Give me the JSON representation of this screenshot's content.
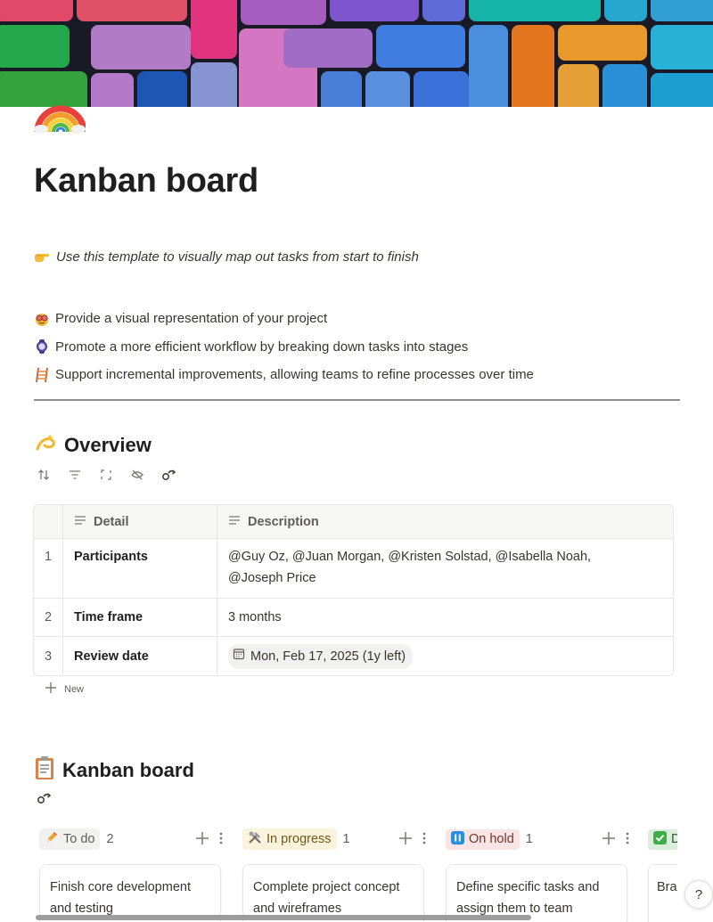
{
  "page": {
    "icon": "rainbow-icon",
    "title": "Kanban board",
    "callout": {
      "icon": "pointing-hand-icon",
      "text": "Use this template to visually map out tasks from start to finish"
    },
    "bullets": [
      {
        "icon": "goggles-face-icon",
        "text": "Provide a visual representation of your project"
      },
      {
        "icon": "watch-icon",
        "text": "Promote a more efficient workflow by breaking down tasks into stages"
      },
      {
        "icon": "ladder-icon",
        "text": "Support incremental improvements, allowing teams to refine processes over time"
      }
    ]
  },
  "overview": {
    "icon": "dizzy-icon",
    "heading": "Overview",
    "toolbar": [
      "sort-icon",
      "filter-icon",
      "expand-icon",
      "hidden-icon",
      "link-icon"
    ],
    "columns": {
      "detail": "Detail",
      "description": "Description"
    },
    "rows": [
      {
        "num": "1",
        "detail": "Participants",
        "description": "@Guy Oz, @Juan Morgan, @Kristen Solstad, @Isabella Noah, @Joseph Price"
      },
      {
        "num": "2",
        "detail": "Time frame",
        "description": "3 months"
      },
      {
        "num": "3",
        "detail": "Review date",
        "description": "Mon, Feb 17, 2025 (1y left)"
      }
    ],
    "new_label": "New"
  },
  "kanban": {
    "icon": "clipboard-icon",
    "heading": "Kanban board",
    "columns": [
      {
        "label": "To do",
        "count": "2",
        "icon": "pencil-icon",
        "color": "#f1f1ef",
        "text_color": "#5f5e5b",
        "card": "Finish core development and testing"
      },
      {
        "label": "In progress",
        "count": "1",
        "icon": "tools-icon",
        "color": "#fbf3db",
        "text_color": "#6b5a1e",
        "card": "Complete project concept and wireframes"
      },
      {
        "label": "On hold",
        "count": "1",
        "icon": "pause-icon",
        "color": "#fbe4e4",
        "text_color": "#6e3630",
        "card": "Define specific tasks and assign them to team"
      },
      {
        "label": "D",
        "count": "",
        "icon": "check-icon",
        "color": "#dbeddb",
        "text_color": "#2b593f",
        "card": "Brai acti"
      }
    ]
  },
  "help_label": "?"
}
